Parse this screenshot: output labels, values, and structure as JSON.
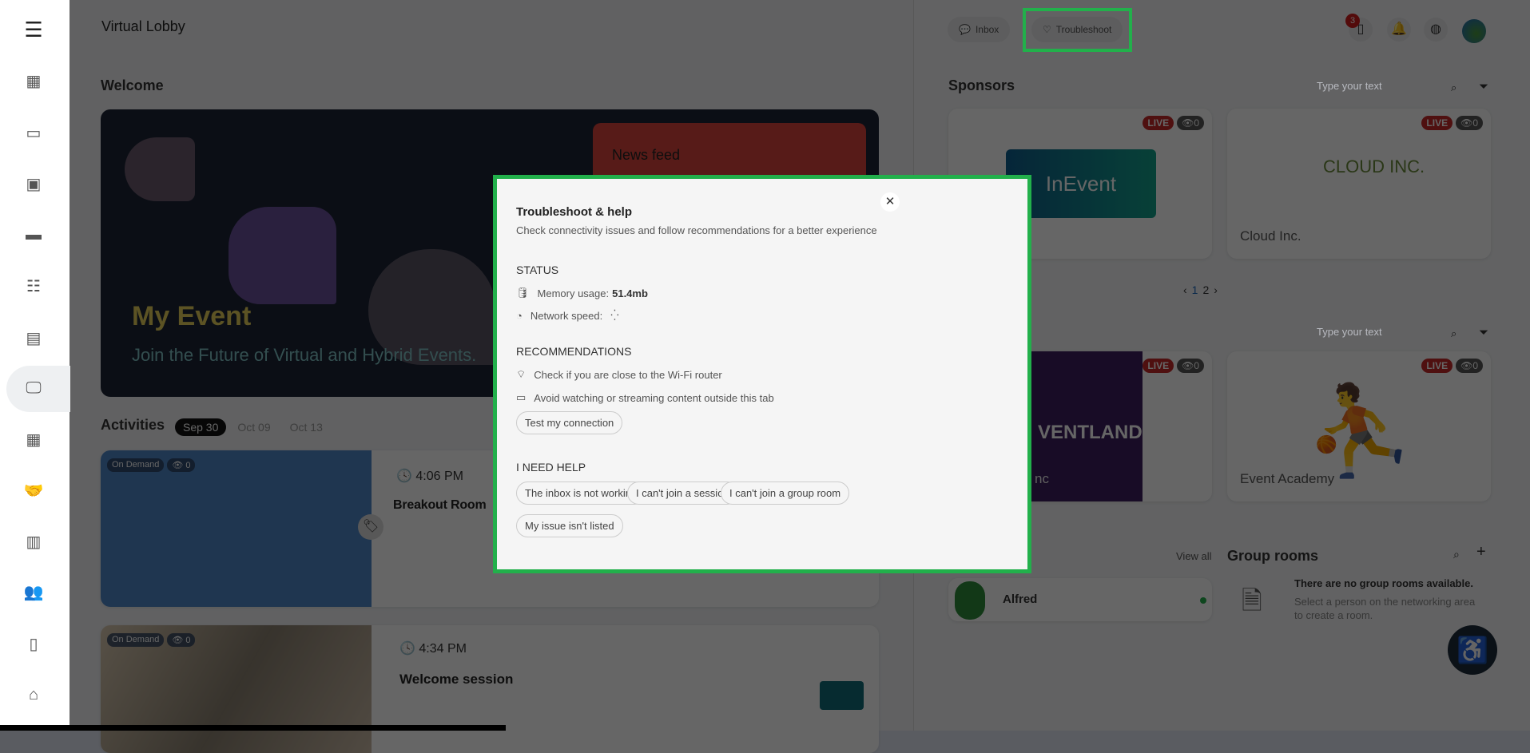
{
  "sidebar": {
    "items": [
      "menu-icon",
      "calendar-grid-icon",
      "calendar-icon",
      "contact-card-icon",
      "ticket-icon",
      "presenter-icon",
      "table-icon",
      "monitor-icon",
      "calendar-grid-icon",
      "handshake-icon",
      "booth-icon",
      "people-icon",
      "book-icon",
      "door-icon"
    ],
    "active": 7
  },
  "header": {
    "title": "Virtual Lobby"
  },
  "welcome": {
    "title": "Welcome",
    "event_name": "My Event",
    "tagline": "Join the Future of Virtual and Hybrid Events.",
    "news_feed": "News feed"
  },
  "activities": {
    "title": "Activities",
    "dates": [
      "Sep 30",
      "Oct 09",
      "Oct 13"
    ],
    "items": [
      {
        "badge": "On Demand",
        "views": "0",
        "time": "4:06 PM",
        "name": "Breakout Room"
      },
      {
        "badge": "On Demand",
        "views": "0",
        "time": "4:34 PM",
        "name": "Welcome session"
      }
    ]
  },
  "topbar": {
    "inbox": "Inbox",
    "troubleshoot": "Troubleshoot",
    "notification_count": "3"
  },
  "sponsors": {
    "title": "Sponsors",
    "search_placeholder": "Type your text",
    "live": "LIVE",
    "cards": [
      {
        "name": "",
        "logo": "InEvent",
        "views": "0"
      },
      {
        "name": "Cloud Inc.",
        "logo": "CLOUD INC.",
        "views": "0"
      }
    ],
    "pagination": [
      "1",
      "2"
    ],
    "current_page": "1"
  },
  "exhibitors": {
    "search_placeholder": "Type your text",
    "cards": [
      {
        "name": "nc",
        "logo": "VENTLAND",
        "views": "0"
      },
      {
        "name": "Event Academy",
        "views": "0"
      }
    ]
  },
  "people": {
    "view_all": "View all",
    "items": [
      {
        "name": "Alfred",
        "online": true
      }
    ]
  },
  "group_rooms": {
    "title": "Group rooms",
    "empty_title": "There are no group rooms available.",
    "empty_text": "Select a person on the networking area to create a room."
  },
  "modal": {
    "title": "Troubleshoot & help",
    "subtitle": "Check connectivity issues and follow recommendations for a better experience",
    "status_heading": "STATUS",
    "memory_label": "Memory usage:",
    "memory_value": "51.4mb",
    "network_label": "Network speed:",
    "rec_heading": "RECOMMENDATIONS",
    "rec_wifi": "Check if you are close to the Wi-Fi router",
    "rec_stream": "Avoid watching or streaming content outside this tab",
    "test_button": "Test my connection",
    "help_heading": "I NEED HELP",
    "help_buttons": [
      "The inbox is not working",
      "I can't join a session",
      "I can't join a group room",
      "My issue isn't listed"
    ]
  },
  "colors": {
    "highlight": "#22b04b",
    "live": "#c62828",
    "online": "#22b04b",
    "accessibility": "#1b2a3a"
  }
}
